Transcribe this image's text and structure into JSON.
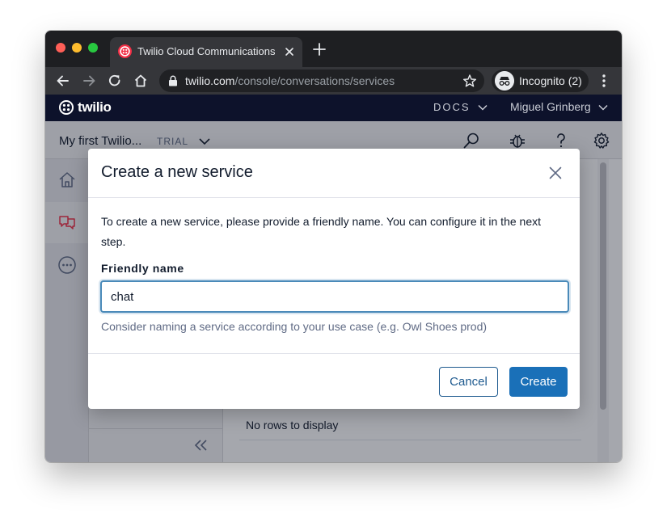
{
  "browser": {
    "tab_title": "Twilio Cloud Communications |",
    "url_domain": "twilio.com",
    "url_path": "/console/conversations/services",
    "incognito_label": "Incognito (2)"
  },
  "twilio_header": {
    "logo_text": "twilio",
    "docs_label": "DOCS",
    "user_name": "Miguel Grinberg"
  },
  "console": {
    "project_name": "My first Twilio...",
    "project_badge": "TRIAL",
    "table_empty_text": "No rows to display"
  },
  "modal": {
    "title": "Create a new service",
    "description": "To create a new service, please provide a friendly name. You can configure it in the next step.",
    "field_label": "Friendly name",
    "field_value": "chat",
    "help_text": "Consider naming a service according to your use case (e.g. Owl Shoes prod)",
    "cancel_label": "Cancel",
    "create_label": "Create"
  },
  "colors": {
    "twilio_red": "#f22f46",
    "header_navy": "#0d122b",
    "primary_button": "#1a70b8",
    "input_focus": "#4a8ab9"
  },
  "icons": [
    "twilio-favicon-icon",
    "close-icon",
    "plus-icon",
    "back-arrow-icon",
    "forward-arrow-icon",
    "reload-icon",
    "home-icon",
    "lock-icon",
    "star-icon",
    "incognito-icon",
    "kebab-menu-icon",
    "chevron-down-icon",
    "search-icon",
    "bug-icon",
    "help-icon",
    "gear-icon",
    "conversations-icon",
    "more-icon",
    "collapse-icon"
  ]
}
